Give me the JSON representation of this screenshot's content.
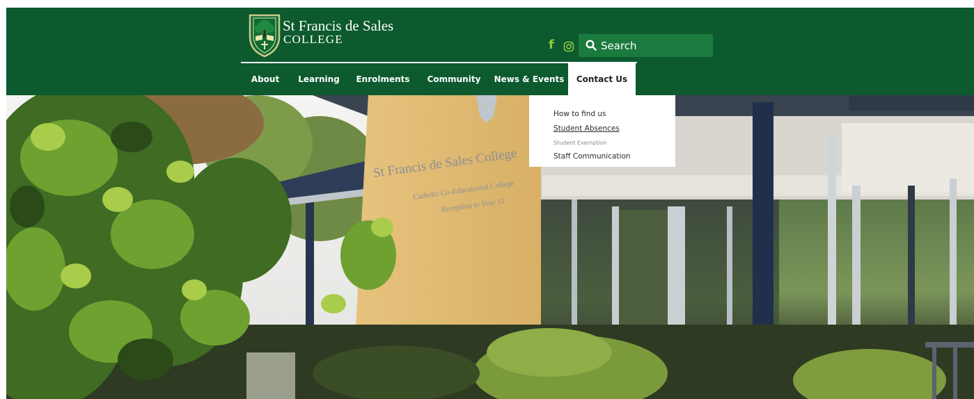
{
  "brand": {
    "name": "St Francis de Sales",
    "sub": "COLLEGE",
    "primary_color": "#0c5a2e",
    "accent_color": "#8ec63f"
  },
  "social": {
    "facebook_icon": "facebook-icon",
    "instagram_icon": "instagram-icon"
  },
  "search": {
    "placeholder": "Search",
    "icon": "search-icon"
  },
  "nav": {
    "items": [
      {
        "label": "About"
      },
      {
        "label": "Learning"
      },
      {
        "label": "Enrolments"
      },
      {
        "label": "Community"
      },
      {
        "label": "News & Events"
      },
      {
        "label": "Contact Us",
        "active": true
      }
    ]
  },
  "dropdown": {
    "items": [
      {
        "label": "How to find us"
      },
      {
        "label": "Student Absences",
        "hovered": true
      },
      {
        "label": "Student Exemption"
      },
      {
        "label": "Staff Communication"
      }
    ]
  },
  "hero": {
    "sign_title": "St Francis de Sales College",
    "sign_line1": "Catholic Co-Educational College",
    "sign_line2": "Reception to Year 12"
  }
}
